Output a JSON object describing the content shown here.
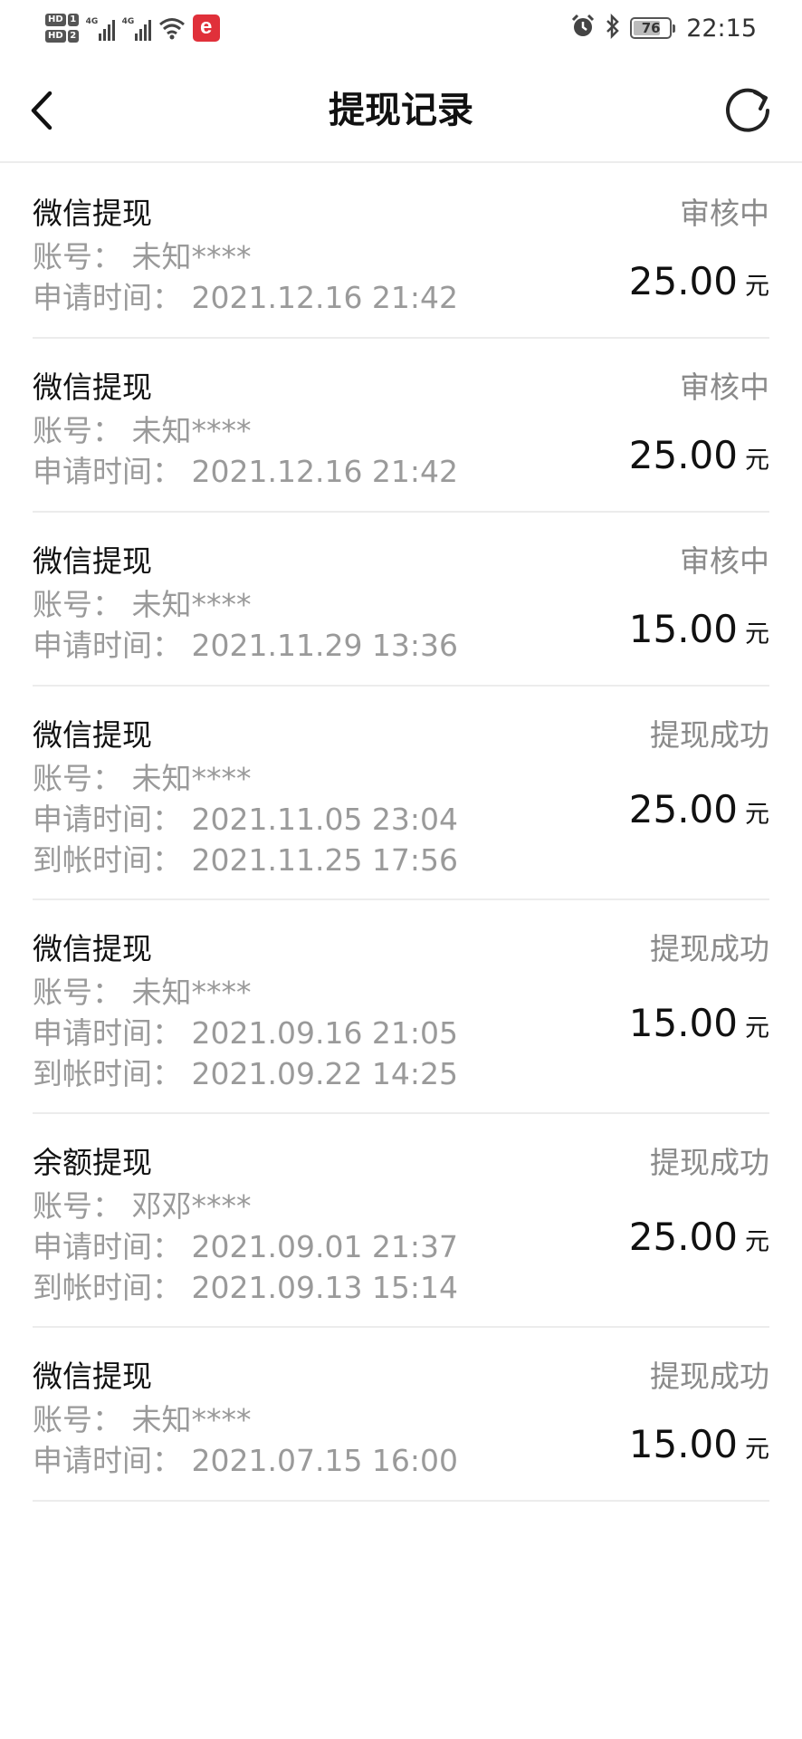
{
  "status_bar": {
    "hd1": "HD",
    "hd1_num": "1",
    "hd2": "HD",
    "hd2_num": "2",
    "net1": "4G",
    "net2": "4G",
    "app_icon": "e",
    "battery_level": 76,
    "battery": "76",
    "time": "22:15",
    "icons": [
      "alarm-icon",
      "bluetooth-icon",
      "wifi-icon",
      "signal-icon",
      "battery-icon"
    ]
  },
  "header": {
    "title": "提现记录",
    "back_icon": "chevron-left-icon",
    "refresh_icon": "refresh-icon"
  },
  "records": [
    {
      "type": "微信提现",
      "status": "审核中",
      "account": "账号：  未知****",
      "apply_time": "申请时间：  2021.12.16 21:42",
      "arrival_time": "",
      "amount": "25.00",
      "unit": "元"
    },
    {
      "type": "微信提现",
      "status": "审核中",
      "account": "账号：  未知****",
      "apply_time": "申请时间：  2021.12.16 21:42",
      "arrival_time": "",
      "amount": "25.00",
      "unit": "元"
    },
    {
      "type": "微信提现",
      "status": "审核中",
      "account": "账号：  未知****",
      "apply_time": "申请时间：  2021.11.29 13:36",
      "arrival_time": "",
      "amount": "15.00",
      "unit": "元"
    },
    {
      "type": "微信提现",
      "status": "提现成功",
      "account": "账号：  未知****",
      "apply_time": "申请时间：  2021.11.05 23:04",
      "arrival_time": "到帐时间：  2021.11.25 17:56",
      "amount": "25.00",
      "unit": "元"
    },
    {
      "type": "微信提现",
      "status": "提现成功",
      "account": "账号：  未知****",
      "apply_time": "申请时间：  2021.09.16 21:05",
      "arrival_time": "到帐时间：  2021.09.22 14:25",
      "amount": "15.00",
      "unit": "元"
    },
    {
      "type": "余额提现",
      "status": "提现成功",
      "account": "账号：  邓邓****",
      "apply_time": "申请时间：  2021.09.01 21:37",
      "arrival_time": "到帐时间：  2021.09.13 15:14",
      "amount": "25.00",
      "unit": "元"
    },
    {
      "type": "微信提现",
      "status": "提现成功",
      "account": "账号：  未知****",
      "apply_time": "申请时间：  2021.07.15 16:00",
      "arrival_time": "",
      "amount": "15.00",
      "unit": "元"
    }
  ]
}
